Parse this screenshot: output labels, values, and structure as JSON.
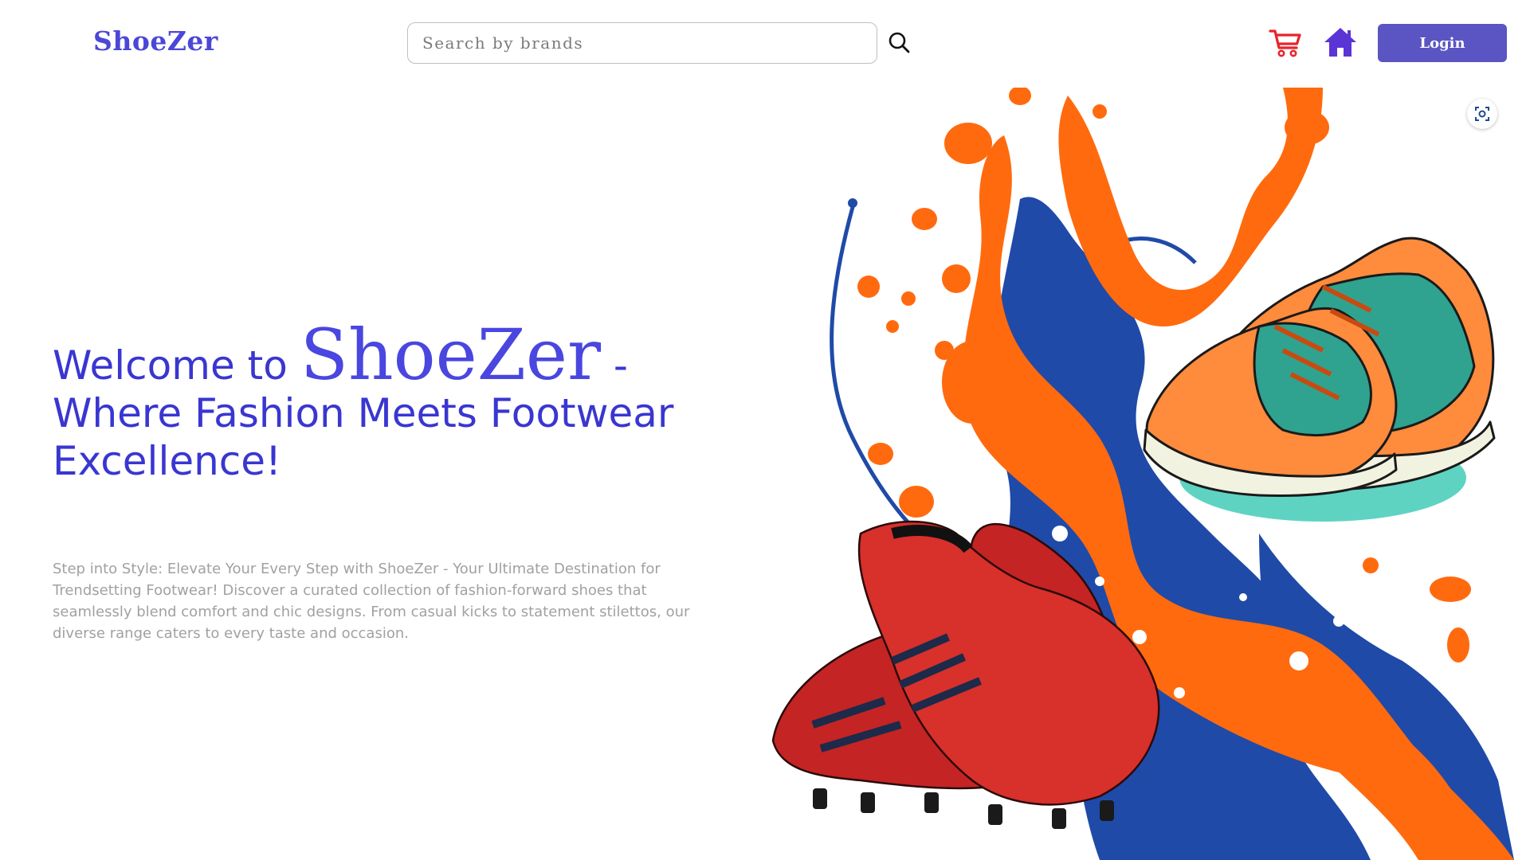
{
  "header": {
    "brand": "ShoeZer",
    "search": {
      "placeholder": "Search by brands",
      "value": ""
    },
    "icons": [
      "search-icon",
      "cart-icon",
      "home-icon"
    ],
    "login_label": "Login"
  },
  "hero": {
    "title_prefix": "Welcome to ",
    "title_brand": "ShoeZer",
    "title_suffix": " -",
    "title_line2": "Where Fashion Meets Footwear Excellence!",
    "description": "Step into Style: Elevate Your Every Step with ShoeZer - Your Ultimate Destination for Trendsetting Footwear! Discover a curated collection of fashion-forward shoes that seamlessly blend comfort and chic designs. From casual kicks to statement stilettos, our diverse range caters to every taste and occasion."
  },
  "illustration": {
    "subject": "sneakers-paint-splash",
    "icon": "lens-icon"
  },
  "colors": {
    "brand": "#4b47d8",
    "title": "#3936d1",
    "button": "#5a55c2",
    "cart": "#e8242b",
    "home": "#5b34d6",
    "description": "#a1a1a1",
    "splash_orange": "#ff6a0f",
    "splash_blue": "#1f4aa8"
  }
}
